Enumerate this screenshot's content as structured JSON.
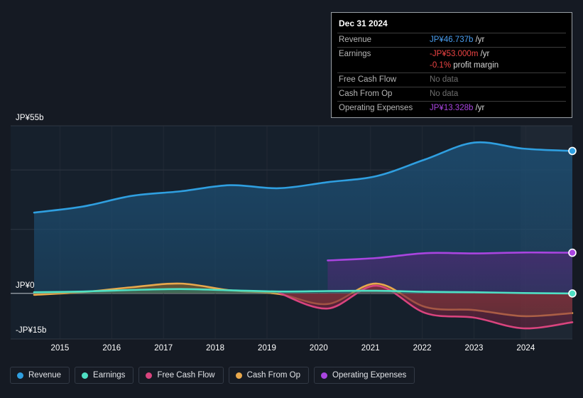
{
  "chart_data": {
    "type": "area",
    "title": "",
    "xlabel": "",
    "ylabel": "",
    "grid": true,
    "currency": "JP¥",
    "x": [
      2014.5,
      2015,
      2016,
      2017,
      2018,
      2019,
      2020,
      2021,
      2022,
      2023,
      2024,
      2024.9
    ],
    "xlim": [
      2014.5,
      2024.9
    ],
    "ylim": [
      -15,
      55
    ],
    "yticks": [
      55,
      0,
      -15
    ],
    "ytick_labels": [
      "JP¥55b",
      "JP¥0",
      "-JP¥15b"
    ],
    "xtick_labels": [
      "2015",
      "2016",
      "2017",
      "2018",
      "2019",
      "2020",
      "2021",
      "2022",
      "2023",
      "2024"
    ],
    "legend_position": "bottom",
    "forecast_band_start": 2023.9,
    "series": [
      {
        "name": "Revenue",
        "color": "#2f9fe0",
        "fill": "#1d4d71",
        "values": [
          26.5,
          28.5,
          32.0,
          33.5,
          35.5,
          34.5,
          36.5,
          38.5,
          44.0,
          49.5,
          47.5,
          46.737
        ]
      },
      {
        "name": "Earnings",
        "color": "#4fe0c4",
        "fill": "#2a7a6c",
        "values": [
          0.35,
          0.6,
          1.1,
          1.4,
          1.0,
          0.6,
          0.75,
          0.85,
          0.5,
          0.35,
          0.1,
          -0.053
        ]
      },
      {
        "name": "Free Cash Flow",
        "color": "#d9447e",
        "fill": "#7a2340",
        "values": [
          null,
          null,
          null,
          null,
          null,
          0.2,
          -5.0,
          2.5,
          -6.5,
          -8.0,
          -11.5,
          -9.5
        ]
      },
      {
        "name": "Cash From Op",
        "color": "#e8a84c",
        "fill": "#7a5a2a",
        "values": [
          -0.5,
          0.4,
          2.0,
          3.2,
          1.0,
          -0.2,
          -3.5,
          3.2,
          -4.5,
          -5.5,
          -7.5,
          -6.5
        ]
      },
      {
        "name": "Operating Expenses",
        "color": "#a945e0",
        "fill": "#4b2b72",
        "values": [
          null,
          null,
          null,
          null,
          null,
          null,
          10.8,
          11.6,
          13.2,
          13.1,
          13.4,
          13.328
        ]
      }
    ]
  },
  "tooltip": {
    "title": "Dec 31 2024",
    "rows": [
      {
        "key": "Revenue",
        "value": "JP¥46.737b",
        "unit": "/yr",
        "color": "#4a9ef0",
        "no_data": false
      },
      {
        "key": "Earnings",
        "value": "-JP¥53.000m",
        "unit": "/yr",
        "color": "#ef4444",
        "no_data": false
      },
      {
        "key": "",
        "value": "-0.1%",
        "unit": "profit margin",
        "color": "#ef4444",
        "no_data": false
      },
      {
        "key": "Free Cash Flow",
        "value": "No data",
        "unit": "",
        "color": "#6f6f6f",
        "no_data": true
      },
      {
        "key": "Cash From Op",
        "value": "No data",
        "unit": "",
        "color": "#6f6f6f",
        "no_data": true
      },
      {
        "key": "Operating Expenses",
        "value": "JP¥13.328b",
        "unit": "/yr",
        "color": "#a945e0",
        "no_data": false
      }
    ]
  },
  "legend": {
    "items": [
      {
        "label": "Revenue",
        "color": "#2f9fe0"
      },
      {
        "label": "Earnings",
        "color": "#4fe0c4"
      },
      {
        "label": "Free Cash Flow",
        "color": "#d9447e"
      },
      {
        "label": "Cash From Op",
        "color": "#e8a84c"
      },
      {
        "label": "Operating Expenses",
        "color": "#a945e0"
      }
    ]
  }
}
